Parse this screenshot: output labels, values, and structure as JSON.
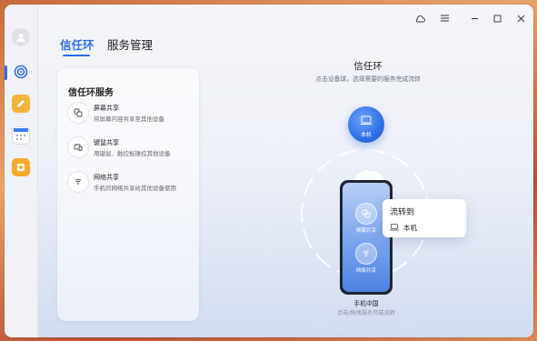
{
  "window": {
    "controls": [
      {
        "name": "cloud-sync-icon"
      },
      {
        "name": "menu-icon"
      },
      {
        "name": "minimize-icon"
      },
      {
        "name": "maximize-icon"
      },
      {
        "name": "close-icon"
      }
    ]
  },
  "sidebar": {
    "items": [
      {
        "name": "avatar"
      },
      {
        "name": "super-device-app",
        "color": "#2f6fe6"
      },
      {
        "name": "notes-app",
        "color": "#f3b43c"
      },
      {
        "name": "calendar-app",
        "color": "#3d7cf0"
      },
      {
        "name": "gallery-app",
        "color": "#f6a92f"
      }
    ]
  },
  "tabs": [
    {
      "label": "信任环",
      "active": true
    },
    {
      "label": "服务管理",
      "active": false
    }
  ],
  "services_panel": {
    "title": "信任环服务",
    "items": [
      {
        "name": "屏幕共享",
        "desc": "将屏幕内容共享至其他设备",
        "icon": "screen-share-icon"
      },
      {
        "name": "键鼠共享",
        "desc": "用键鼠、触控板操控其他设备",
        "icon": "keyboard-mouse-icon"
      },
      {
        "name": "网络共享",
        "desc": "手机的网络共享给其他设备使用",
        "icon": "network-share-icon"
      }
    ]
  },
  "main": {
    "title": "信任环",
    "subtitle": "点击设备球，选择需要的服务完成流转",
    "this_device": {
      "label": "本机",
      "icon": "laptop-icon"
    },
    "phone": {
      "name": "手机中国",
      "hint": "点击/拖拽服务完成流转",
      "tiles": [
        {
          "label": "屏幕共享",
          "icon": "screen-share-icon"
        },
        {
          "label": "网络共享",
          "icon": "network-share-icon"
        }
      ]
    },
    "popup": {
      "title": "流转到",
      "item": "本机"
    }
  },
  "colors": {
    "accent": "#2f6fe6"
  }
}
